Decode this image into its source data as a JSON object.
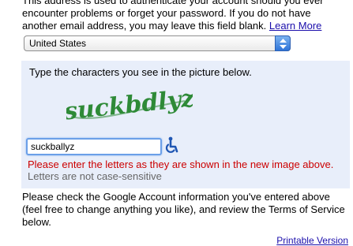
{
  "intro": {
    "text": "This address is used to authenticate your account should you ever encounter problems or forget your password. If you do not have another email address, you may leave this field blank.",
    "learn_more": "Learn More"
  },
  "location": {
    "selected": "United States"
  },
  "captcha": {
    "instruction": "Type the characters you see in the picture below.",
    "image_text": "suckbdlyz",
    "input_value": "suckballyz",
    "error": "Please enter the letters as they are shown in the new image above.",
    "hint": "Letters are not case-sensitive",
    "audio_icon": "wheelchair-accessibility-icon"
  },
  "review": {
    "text": "Please check the Google Account information you've entered above (feel free to change anything you like), and review the Terms of Service below."
  },
  "footer": {
    "printable_version": "Printable Version"
  },
  "colors": {
    "error": "#cc0000",
    "link": "#1a0dab",
    "captcha_background": "#e8eefa",
    "captcha_text": "#2e8a37"
  }
}
